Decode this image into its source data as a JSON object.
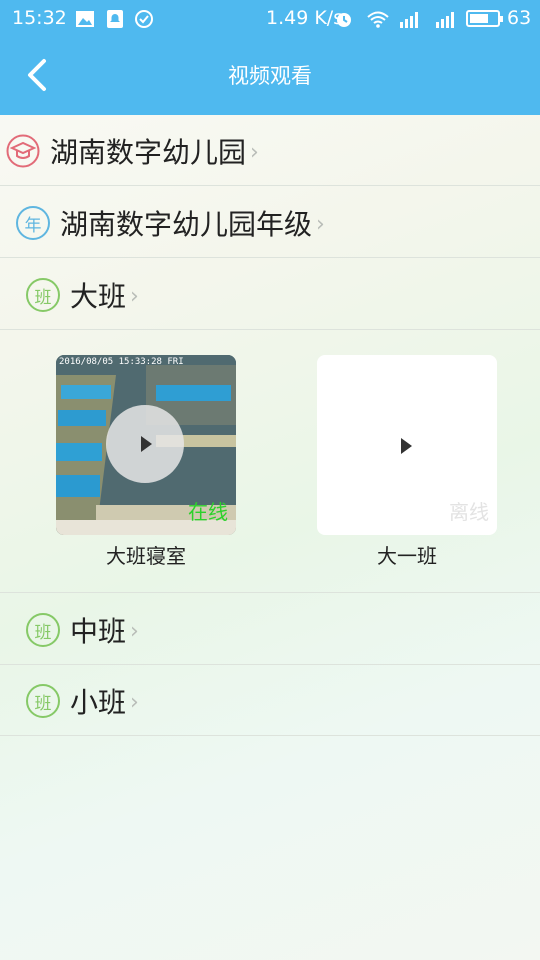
{
  "statusbar": {
    "time": "15:32",
    "speed": "1.49 K/s",
    "battery": "63"
  },
  "header": {
    "title": "视频观看"
  },
  "rows_top": [
    {
      "label": "湖南数字幼儿园"
    },
    {
      "label": "湖南数字幼儿园年级",
      "badge": "年"
    },
    {
      "label": "大班",
      "badge": "班"
    }
  ],
  "cameras": [
    {
      "name": "大班寝室",
      "status": "在线",
      "status_color": "#2bd12b",
      "osd": "2016/08/05 15:33:28 FRI"
    },
    {
      "name": "大一班",
      "status": "离线",
      "status_color": "#e3e3e3"
    }
  ],
  "rows_bottom": [
    {
      "label": "中班",
      "badge": "班"
    },
    {
      "label": "小班",
      "badge": "班"
    }
  ],
  "colors": {
    "accent": "#4fb9ef",
    "badge_green": "#86c967",
    "badge_blue": "#5fb6e0",
    "badge_red": "#e26b78"
  }
}
